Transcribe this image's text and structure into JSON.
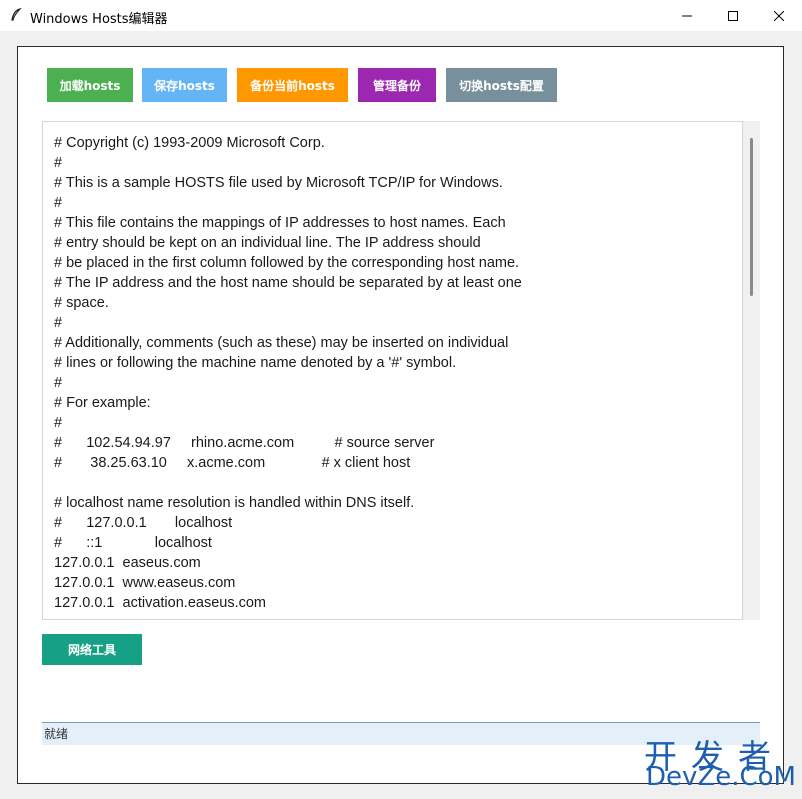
{
  "window": {
    "title": "Windows Hosts编辑器",
    "icon": "feather-icon"
  },
  "toolbar": {
    "buttons": [
      {
        "label": "加载hosts",
        "color": "#4caf50"
      },
      {
        "label": "保存hosts",
        "color": "#64b5f6"
      },
      {
        "label": "备份当前hosts",
        "color": "#ff9800"
      },
      {
        "label": "管理备份",
        "color": "#9c27b0"
      },
      {
        "label": "切换hosts配置",
        "color": "#78909c"
      }
    ]
  },
  "editor": {
    "content": "# Copyright (c) 1993-2009 Microsoft Corp.\n#\n# This is a sample HOSTS file used by Microsoft TCP/IP for Windows.\n#\n# This file contains the mappings of IP addresses to host names. Each\n# entry should be kept on an individual line. The IP address should\n# be placed in the first column followed by the corresponding host name.\n# The IP address and the host name should be separated by at least one\n# space.\n#\n# Additionally, comments (such as these) may be inserted on individual\n# lines or following the machine name denoted by a '#' symbol.\n#\n# For example:\n#\n#      102.54.94.97     rhino.acme.com          # source server\n#       38.25.63.10     x.acme.com              # x client host\n\n# localhost name resolution is handled within DNS itself.\n#\t127.0.0.1       localhost\n#\t::1             localhost\n127.0.0.1  easeus.com\n127.0.0.1  www.easeus.com\n127.0.0.1  activation.easeus.com"
  },
  "tools": {
    "network_label": "网络工具",
    "network_color": "#16a085"
  },
  "status": {
    "text": "就绪"
  },
  "watermark": {
    "line1": "开发者",
    "line2": "DevZe.CoM"
  }
}
